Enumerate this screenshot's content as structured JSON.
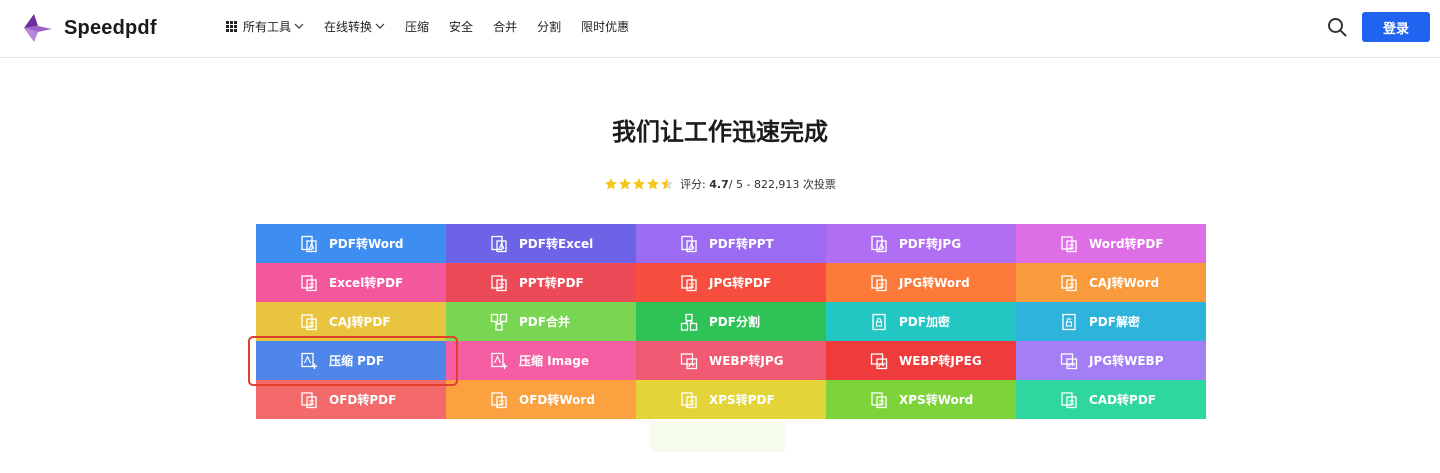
{
  "brand": {
    "name": "Speedpdf",
    "logo_color": "#7b3fa8"
  },
  "nav": {
    "items": [
      {
        "label": "所有工具",
        "has_grid": true,
        "has_dropdown": true
      },
      {
        "label": "在线转换",
        "has_grid": false,
        "has_dropdown": true
      },
      {
        "label": "压缩",
        "has_grid": false,
        "has_dropdown": false
      },
      {
        "label": "安全",
        "has_grid": false,
        "has_dropdown": false
      },
      {
        "label": "合并",
        "has_grid": false,
        "has_dropdown": false
      },
      {
        "label": "分割",
        "has_grid": false,
        "has_dropdown": false
      },
      {
        "label": "限时优惠",
        "has_grid": false,
        "has_dropdown": false
      }
    ]
  },
  "header": {
    "login_label": "登录",
    "login_color": "#1f63f0",
    "search_icon": "search-icon"
  },
  "hero": {
    "title": "我们让工作迅速完成",
    "rating": {
      "label": "评分:",
      "score": "4.7",
      "rest": " / 5 - 822,913 次投票",
      "stars": 4.5,
      "star_color": "#f5c518"
    }
  },
  "tools": [
    {
      "label": "PDF转Word",
      "color": "#3d8ef0",
      "icon": "pdf-to-doc-icon"
    },
    {
      "label": "PDF转Excel",
      "color": "#6d63e6",
      "icon": "pdf-to-doc-icon"
    },
    {
      "label": "PDF转PPT",
      "color": "#9b6cf2",
      "icon": "pdf-to-doc-icon"
    },
    {
      "label": "PDF转JPG",
      "color": "#b06ff2",
      "icon": "pdf-to-doc-icon"
    },
    {
      "label": "Word转PDF",
      "color": "#dd6ee6",
      "icon": "doc-to-pdf-icon"
    },
    {
      "label": "Excel转PDF",
      "color": "#f3589c",
      "icon": "doc-to-pdf-icon"
    },
    {
      "label": "PPT转PDF",
      "color": "#ec4a56",
      "icon": "doc-to-pdf-icon"
    },
    {
      "label": "JPG转PDF",
      "color": "#f64d3e",
      "icon": "doc-to-pdf-icon"
    },
    {
      "label": "JPG转Word",
      "color": "#fb7a3a",
      "icon": "doc-to-pdf-icon"
    },
    {
      "label": "CAJ转Word",
      "color": "#f99b3d",
      "icon": "doc-to-pdf-icon"
    },
    {
      "label": "CAJ转PDF",
      "color": "#e9c43e",
      "icon": "doc-to-pdf-icon"
    },
    {
      "label": "PDF合并",
      "color": "#79d652",
      "icon": "merge-icon"
    },
    {
      "label": "PDF分割",
      "color": "#2ec257",
      "icon": "split-icon"
    },
    {
      "label": "PDF加密",
      "color": "#22c6c2",
      "icon": "lock-icon"
    },
    {
      "label": "PDF解密",
      "color": "#2eb4dc",
      "icon": "unlock-icon"
    },
    {
      "label": "压缩 PDF",
      "color": "#4f86ea",
      "icon": "compress-icon"
    },
    {
      "label": "压缩 Image",
      "color": "#f65ea4",
      "icon": "compress-icon"
    },
    {
      "label": "WEBP转JPG",
      "color": "#f05a73",
      "icon": "image-convert-icon"
    },
    {
      "label": "WEBP转JPEG",
      "color": "#ee3b3b",
      "icon": "image-convert-icon"
    },
    {
      "label": "JPG转WEBP",
      "color": "#a47ef4",
      "icon": "image-convert-icon"
    },
    {
      "label": "OFD转PDF",
      "color": "#f46a6a",
      "icon": "doc-to-pdf-icon"
    },
    {
      "label": "OFD转Word",
      "color": "#fba13f",
      "icon": "doc-to-pdf-icon"
    },
    {
      "label": "XPS转PDF",
      "color": "#e3d43a",
      "icon": "doc-to-pdf-icon"
    },
    {
      "label": "XPS转Word",
      "color": "#7cd43a",
      "icon": "doc-to-pdf-icon"
    },
    {
      "label": "CAD转PDF",
      "color": "#2fd7a0",
      "icon": "doc-to-pdf-icon"
    }
  ]
}
